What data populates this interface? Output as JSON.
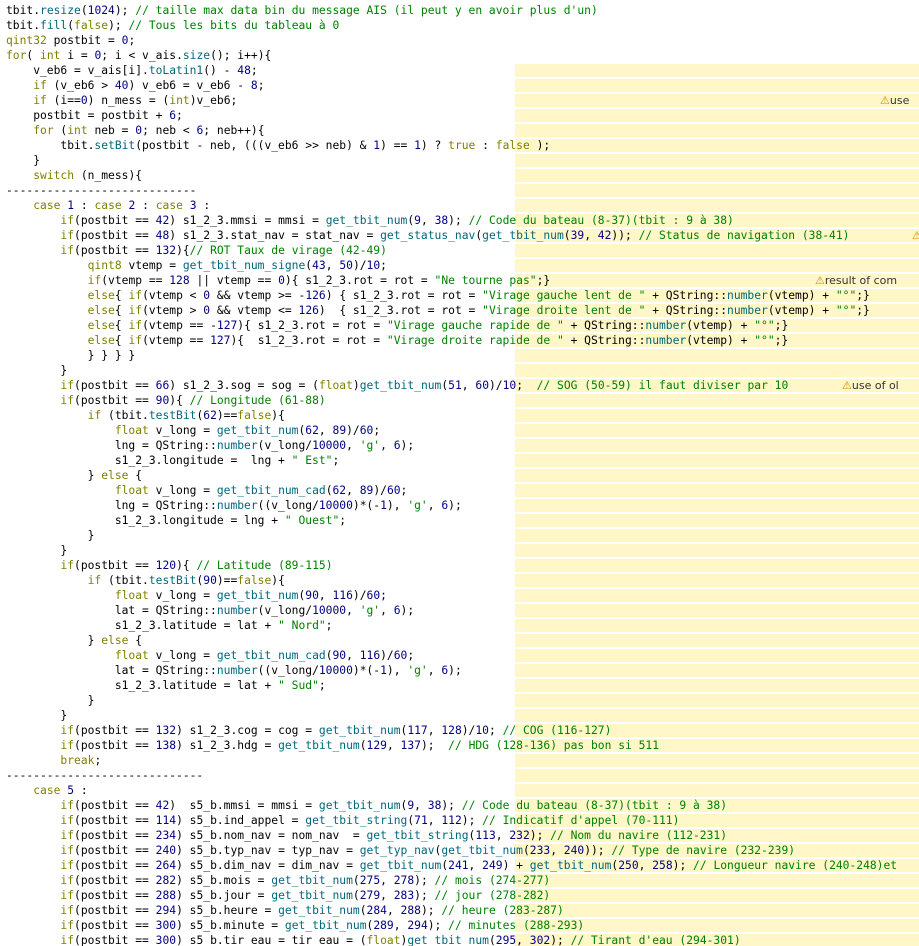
{
  "editor": {
    "lines": [
      "tbit.resize(1024); // taille max data bin du message AIS (il peut y en avoir plus d'un)",
      "tbit.fill(false); // Tous les bits du tableau à 0",
      "qint32 postbit = 0;",
      "for( int i = 0; i < v_ais.size(); i++){",
      "    v_eb6 = v_ais[i].toLatin1() - 48;",
      "    if (v_eb6 > 40) v_eb6 = v_eb6 - 8;",
      "    if (i==0) n_mess = (int)v_eb6;",
      "    postbit = postbit + 6;",
      "    for (int neb = 0; neb < 6; neb++){",
      "        tbit.setBit(postbit - neb, (((v_eb6 >> neb) & 1) == 1) ? true : false );",
      "    }",
      "    switch (n_mess){",
      "----------------------------",
      "    case 1 : case 2 : case 3 :",
      "        if(postbit == 42) s1_2_3.mmsi = mmsi = get_tbit_num(9, 38); // Code du bateau (8-37)(tbit : 9 à 38)",
      "        if(postbit == 48) s1_2_3.stat_nav = stat_nav = get_status_nav(get_tbit_num(39, 42)); // Status de navigation (38-41)",
      "        if(postbit == 132){// ROT Taux de virage (42-49)",
      "            qint8 vtemp = get_tbit_num_signe(43, 50)/10;",
      "            if(vtemp == 128 || vtemp == 0){ s1_2_3.rot = rot = \"Ne tourne pas\";}",
      "            else{ if(vtemp < 0 && vtemp >= -126) { s1_2_3.rot = rot = \"Virage gauche lent de \" + QString::number(vtemp) + \"°\";}",
      "            else{ if(vtemp > 0 && vtemp <= 126)  { s1_2_3.rot = rot = \"Virage droite lent de \" + QString::number(vtemp) + \"°\";}",
      "            else{ if(vtemp == -127){ s1_2_3.rot = rot = \"Virage gauche rapide de \" + QString::number(vtemp) + \"°\";}",
      "            else{ if(vtemp == 127){  s1_2_3.rot = rot = \"Virage droite rapide de \" + QString::number(vtemp) + \"°\";}",
      "            } } } }",
      "        }",
      "        if(postbit == 66) s1_2_3.sog = sog = (float)get_tbit_num(51, 60)/10;  // SOG (50-59) il faut diviser par 10",
      "        if(postbit == 90){ // Longitude (61-88)",
      "            if (tbit.testBit(62)==false){",
      "                float v_long = get_tbit_num(62, 89)/60;",
      "                lng = QString::number(v_long/10000, 'g', 6);",
      "                s1_2_3.longitude =  lng + \" Est\";",
      "            } else {",
      "                float v_long = get_tbit_num_cad(62, 89)/60;",
      "                lng = QString::number((v_long/10000)*(-1), 'g', 6);",
      "                s1_2_3.longitude = lng + \" Ouest\";",
      "            }",
      "        }",
      "        if(postbit == 120){ // Latitude (89-115)",
      "            if (tbit.testBit(90)==false){",
      "                float v_long = get_tbit_num(90, 116)/60;",
      "                lat = QString::number(v_long/10000, 'g', 6);",
      "                s1_2_3.latitude = lat + \" Nord\";",
      "            } else {",
      "                float v_long = get_tbit_num_cad(90, 116)/60;",
      "                lat = QString::number((v_long/10000)*(-1), 'g', 6);",
      "                s1_2_3.latitude = lat + \" Sud\";",
      "            }",
      "        }",
      "        if(postbit == 132) s1_2_3.cog = cog = get_tbit_num(117, 128)/10; // COG (116-127)",
      "        if(postbit == 138) s1_2_3.hdg = get_tbit_num(129, 137);  // HDG (128-136) pas bon si 511",
      "        break;",
      "-----------------------------",
      "    case 5 :",
      "        if(postbit == 42)  s5_b.mmsi = mmsi = get_tbit_num(9, 38); // Code du bateau (8-37)(tbit : 9 à 38)",
      "        if(postbit == 114) s5_b.ind_appel = get_tbit_string(71, 112); // Indicatif d'appel (70-111)",
      "        if(postbit == 234) s5_b.nom_nav = nom_nav  = get_tbit_string(113, 232); // Nom du navire (112-231)",
      "        if(postbit == 240) s5_b.typ_nav = typ_nav = get_typ_nav(get_tbit_num(233, 240)); // Type de navire (232-239)",
      "        if(postbit == 264) s5_b.dim_nav = dim_nav = get_tbit_num(241, 249) + get_tbit_num(250, 258); // Longueur navire (240-248)et",
      "        if(postbit == 282) s5_b.mois = get_tbit_num(275, 278); // mois (274-277)",
      "        if(postbit == 288) s5_b.jour = get_tbit_num(279, 283); // jour (278-282)",
      "        if(postbit == 294) s5_b.heure = get_tbit_num(284, 288); // heure (283-287)",
      "        if(postbit == 300) s5_b.minute = get_tbit_num(289, 294); // minutes (288-293)",
      "        if(postbit == 300) s5_b.tir_eau = tir_eau = (float)get_tbit_num(295, 302); // Tirant d'eau (294-301)"
    ],
    "warnings": [
      {
        "line": 6,
        "text": "use"
      },
      {
        "line": 15,
        "text": ""
      },
      {
        "line": 18,
        "text": "result of com"
      },
      {
        "line": 25,
        "text": "use of ol"
      }
    ]
  }
}
